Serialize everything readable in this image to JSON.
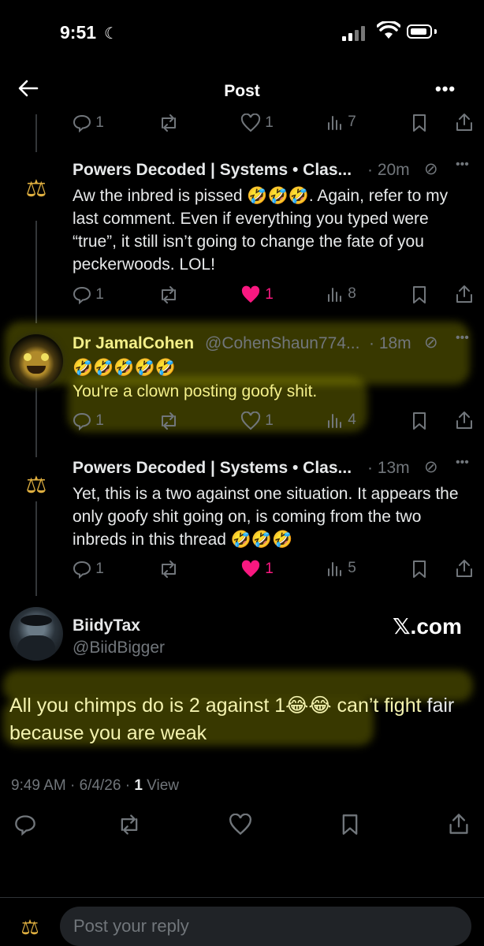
{
  "status_bar": {
    "time": "9:51"
  },
  "header": {
    "title": "Post"
  },
  "top_actions": {
    "replies": "1",
    "likes": "1",
    "views": "7"
  },
  "replies": [
    {
      "name": "Powers Decoded | Systems • Clas...",
      "meta": "· 20m",
      "text": "Aw the inbred is pissed 🤣🤣🤣. Again, refer to my last comment. Even if everything you typed were “true”, it still isn’t going to change the fate of you peckerwoods. LOL!",
      "replies_count": "1",
      "likes": "1",
      "views": "8"
    },
    {
      "name": "Dr JamalCohen",
      "handle": "@CohenShaun774...",
      "meta": "· 18m",
      "emojis": "🤣🤣🤣🤣🤣",
      "text": "You're a clown posting goofy shit.",
      "replies_count": "1",
      "likes": "1",
      "views": "4"
    },
    {
      "name": "Powers Decoded | Systems • Clas...",
      "meta": "· 13m",
      "text": "Yet, this is a two against one situation. It appears the only goofy shit going on, is coming from the two inbreds in this thread 🤣🤣🤣",
      "replies_count": "1",
      "likes": "1",
      "views": "5"
    }
  ],
  "main_post": {
    "name": "BiidyTax",
    "handle": "@BiidBigger",
    "watermark": "𝕏.com",
    "text_highlighted_1": "All you chimps do is 2 against 1😂😂 can’t fight",
    "text_plain_1": " fair",
    "text_highlighted_2": "because you are weak",
    "time": "9:49 AM · 6/4/26 · ",
    "views_count": "1",
    "views_label": " View"
  },
  "reply_box": {
    "placeholder": "Post your reply"
  },
  "colors": {
    "like_active": "#f91880",
    "highlight": "#f4f08a",
    "muted": "#71767b"
  }
}
